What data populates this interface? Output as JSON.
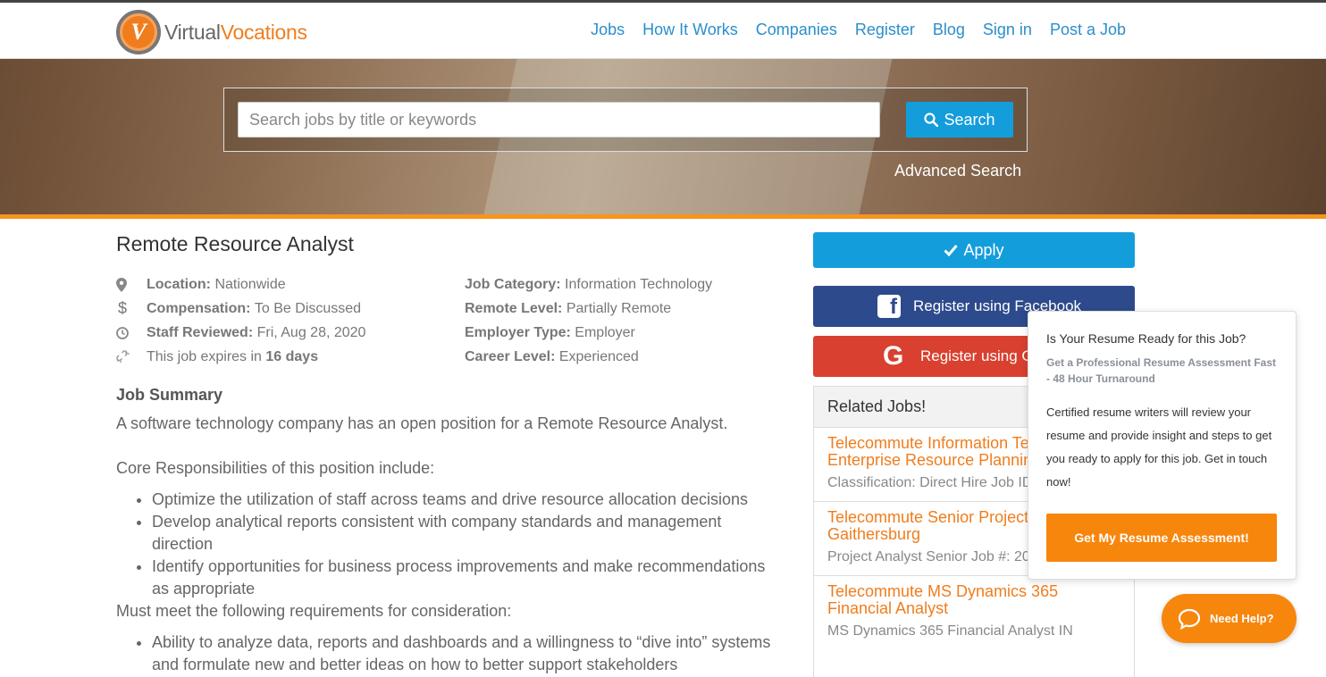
{
  "header": {
    "logo_letter": "V",
    "logo_part1": "Virtual",
    "logo_part2": "Vocations",
    "nav": [
      "Jobs",
      "How It Works",
      "Companies",
      "Register",
      "Blog",
      "Sign in",
      "Post a Job"
    ]
  },
  "hero": {
    "search_placeholder": "Search jobs by title or keywords",
    "search_button": "Search",
    "advanced_search": "Advanced Search"
  },
  "job": {
    "title": "Remote Resource Analyst",
    "meta_left": [
      {
        "icon": "map-pin-icon",
        "label": "Location:",
        "value": "Nationwide"
      },
      {
        "icon": "dollar-icon",
        "label": "Compensation:",
        "value": "To Be Discussed"
      },
      {
        "icon": "clock-icon",
        "label": "Staff Reviewed:",
        "value": "Fri, Aug 28, 2020"
      }
    ],
    "expires_prefix": "This job expires in ",
    "expires_value": "16 days",
    "meta_right": [
      {
        "label": "Job Category:",
        "value": "Information Technology"
      },
      {
        "label": "Remote Level:",
        "value": "Partially Remote"
      },
      {
        "label": "Employer Type:",
        "value": "Employer"
      },
      {
        "label": "Career Level:",
        "value": "Experienced"
      }
    ],
    "summary_heading": "Job Summary",
    "summary_text": "A software technology company has an open position for a Remote Resource Analyst.",
    "responsibilities_intro": "Core Responsibilities of this position include:",
    "responsibilities": [
      "Optimize the utilization of staff across teams and drive resource allocation decisions",
      "Develop analytical reports consistent with company standards and management direction",
      "Identify opportunities for business process improvements and make recommendations as appropriate"
    ],
    "requirements_intro": "Must meet the following requirements for consideration:",
    "requirements": [
      "Ability to analyze data, reports and dashboards and a willingness to “dive into” systems and formulate new and better ideas on how to better support stakeholders"
    ]
  },
  "sidebar": {
    "apply": "Apply",
    "facebook": "Register using Facebook",
    "google": "Register using Google",
    "related_heading": "Related Jobs!",
    "related": [
      {
        "title": "Telecommute Information Technology Enterprise Resource Planning Vail",
        "desc": "Classification: Direct Hire Job ID"
      },
      {
        "title": "Telecommute Senior Project Analyst in Gaithersburg",
        "desc": "Project Analyst Senior Job #: 20 Position..."
      },
      {
        "title": "Telecommute MS Dynamics 365 Financial Analyst",
        "desc": "MS Dynamics 365 Financial Analyst IN"
      }
    ]
  },
  "popup": {
    "title": "Is Your Resume Ready for this Job?",
    "subtitle": "Get a Professional Resume Assessment Fast - 48 Hour Turnaround",
    "body": "Certified resume writers will review your resume and provide insight and steps to get you ready to apply for this job. Get in touch now!",
    "cta": "Get My Resume Assessment!"
  },
  "help": {
    "label": "Need Help?"
  },
  "colors": {
    "accent_blue": "#149ddb",
    "brand_orange": "#f07d1d",
    "facebook": "#2d4a8c",
    "google": "#d9402f"
  }
}
